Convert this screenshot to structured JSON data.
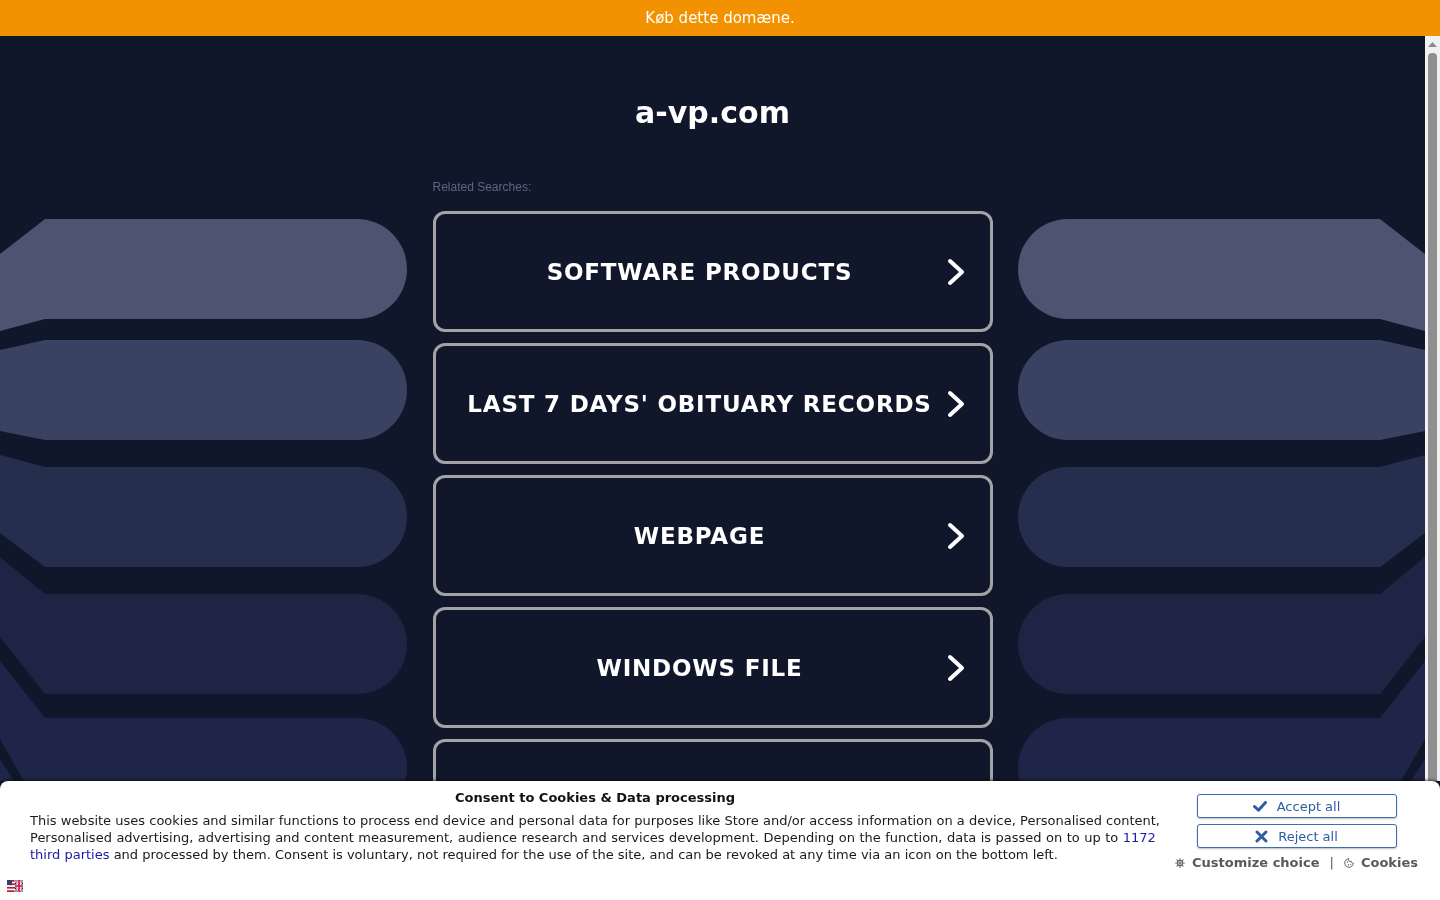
{
  "banner": {
    "text": "Køb dette domæne."
  },
  "site_title": "a-vp.com",
  "related_searches": {
    "heading": "Related Searches:",
    "items": [
      {
        "kind": "link",
        "label": "SOFTWARE PRODUCTS"
      },
      {
        "kind": "link",
        "label": "LAST 7 DAYS' OBITUARY RECORDS"
      },
      {
        "kind": "link",
        "label": "WEBPAGE"
      },
      {
        "kind": "link",
        "label": "WINDOWS FILE"
      },
      {
        "kind": "covered"
      }
    ]
  },
  "consent_dialog": {
    "title": "Consent to Cookies & Data processing",
    "text_parts": [
      {
        "kind": "text",
        "text": "This website uses cookies and similar functions to process end device and personal data for purposes like Store and/or access information on a device, Personalised content, Personalised advertising, advertising and content measurement, audience research and services development. Depending on the function, data is passed on to up to "
      },
      {
        "kind": "link",
        "text": "1172"
      },
      {
        "kind": "link",
        "text": "third parties"
      },
      {
        "kind": "text",
        "text": " and processed by them. Consent is voluntary, not required for the use of the site, and can be revoked at any time via an icon on the bottom left."
      }
    ],
    "buttons": [
      {
        "kind": "accept",
        "label": "Accept all"
      },
      {
        "kind": "reject",
        "label": "Reject all"
      }
    ],
    "links": [
      {
        "kind": "customize",
        "label": "Customize choice"
      },
      {
        "kind": "cookies",
        "label": "Cookies"
      }
    ],
    "separator": "|"
  }
}
